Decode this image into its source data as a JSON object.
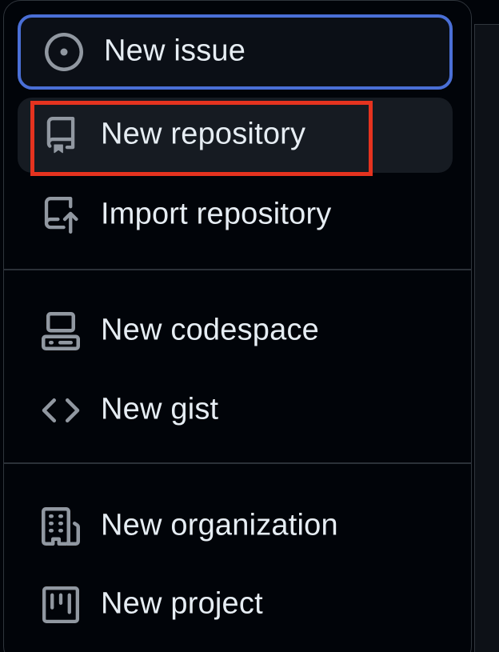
{
  "menu": {
    "groups": [
      {
        "items": [
          {
            "label": "New issue",
            "icon": "issue-opened-icon"
          },
          {
            "label": "New repository",
            "icon": "repo-icon"
          },
          {
            "label": "Import repository",
            "icon": "repo-push-icon"
          }
        ]
      },
      {
        "items": [
          {
            "label": "New codespace",
            "icon": "codespaces-icon"
          },
          {
            "label": "New gist",
            "icon": "code-icon"
          }
        ]
      },
      {
        "items": [
          {
            "label": "New organization",
            "icon": "organization-icon"
          },
          {
            "label": "New project",
            "icon": "project-icon"
          }
        ]
      }
    ]
  },
  "colors": {
    "background": "#010409",
    "text": "#e6edf3",
    "icon": "#9198a1",
    "focus_ring": "#4a6fd6",
    "hover_bg": "#161b22",
    "highlight_box": "#e5331f",
    "border": "#2f353c"
  }
}
